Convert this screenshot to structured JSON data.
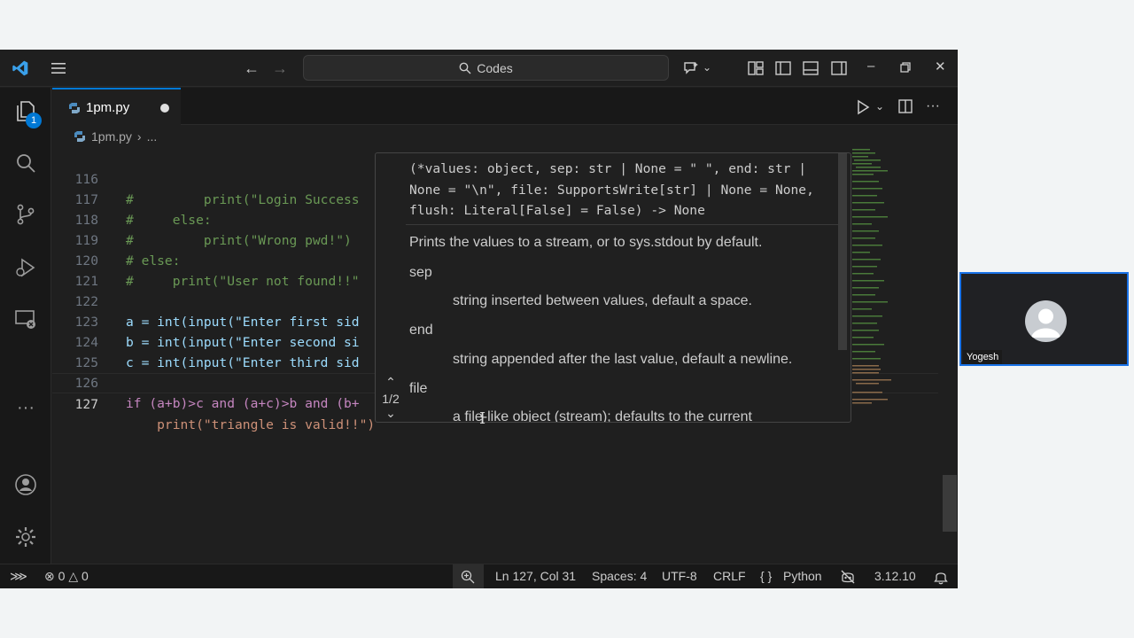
{
  "app": {
    "search_text": "Codes",
    "tab_label": "1pm.py",
    "breadcrumb_file": "1pm.py",
    "breadcrumb_more": "...",
    "explorer_badge": "1"
  },
  "editor": {
    "lines": [
      {
        "n": "116",
        "t": "#         print(\"Login Success"
      },
      {
        "n": "117",
        "t": "#     else:"
      },
      {
        "n": "118",
        "t": "#         print(\"Wrong pwd!\")"
      },
      {
        "n": "119",
        "t": "# else:"
      },
      {
        "n": "120",
        "t": "#     print(\"User not found!!\""
      },
      {
        "n": "121",
        "t": ""
      },
      {
        "n": "122",
        "t": "a = int(input(\"Enter first sid"
      },
      {
        "n": "123",
        "t": "b = int(input(\"Enter second si"
      },
      {
        "n": "124",
        "t": "c = int(input(\"Enter third sid"
      },
      {
        "n": "125",
        "t": ""
      },
      {
        "n": "126",
        "t": "if (a+b)>c and (a+c)>b and (b+"
      },
      {
        "n": "127",
        "t": "    print(\"triangle is valid!!\")"
      }
    ]
  },
  "hover": {
    "sig_line1": "(*values: object, sep: str | None = \" \", end: str |",
    "sig_line2": "None = \"\\n\", file: SupportsWrite[str] | None = None,",
    "sig_line3": "flush: Literal[False] = False) -> None",
    "doc_intro": "Prints the values to a stream, or to sys.stdout by default.",
    "param_sep": "sep",
    "param_sep_desc": "string inserted between values, default a space.",
    "param_end": "end",
    "param_end_desc": "string appended after the last value, default a newline.",
    "param_file": "file",
    "param_file_desc": "a file-like object (stream); defaults to the current",
    "overload_counter": "1/2"
  },
  "status": {
    "errors": "0",
    "warnings": "0",
    "position": "Ln 127, Col 31",
    "spaces": "Spaces: 4",
    "encoding": "UTF-8",
    "eol": "CRLF",
    "language": "Python",
    "language_braces": "{ }",
    "python_version": "3.12.10"
  },
  "participant": {
    "name": "Yogesh"
  },
  "colors": {
    "accent": "#0078d4",
    "tile_border": "#1a73e8"
  }
}
